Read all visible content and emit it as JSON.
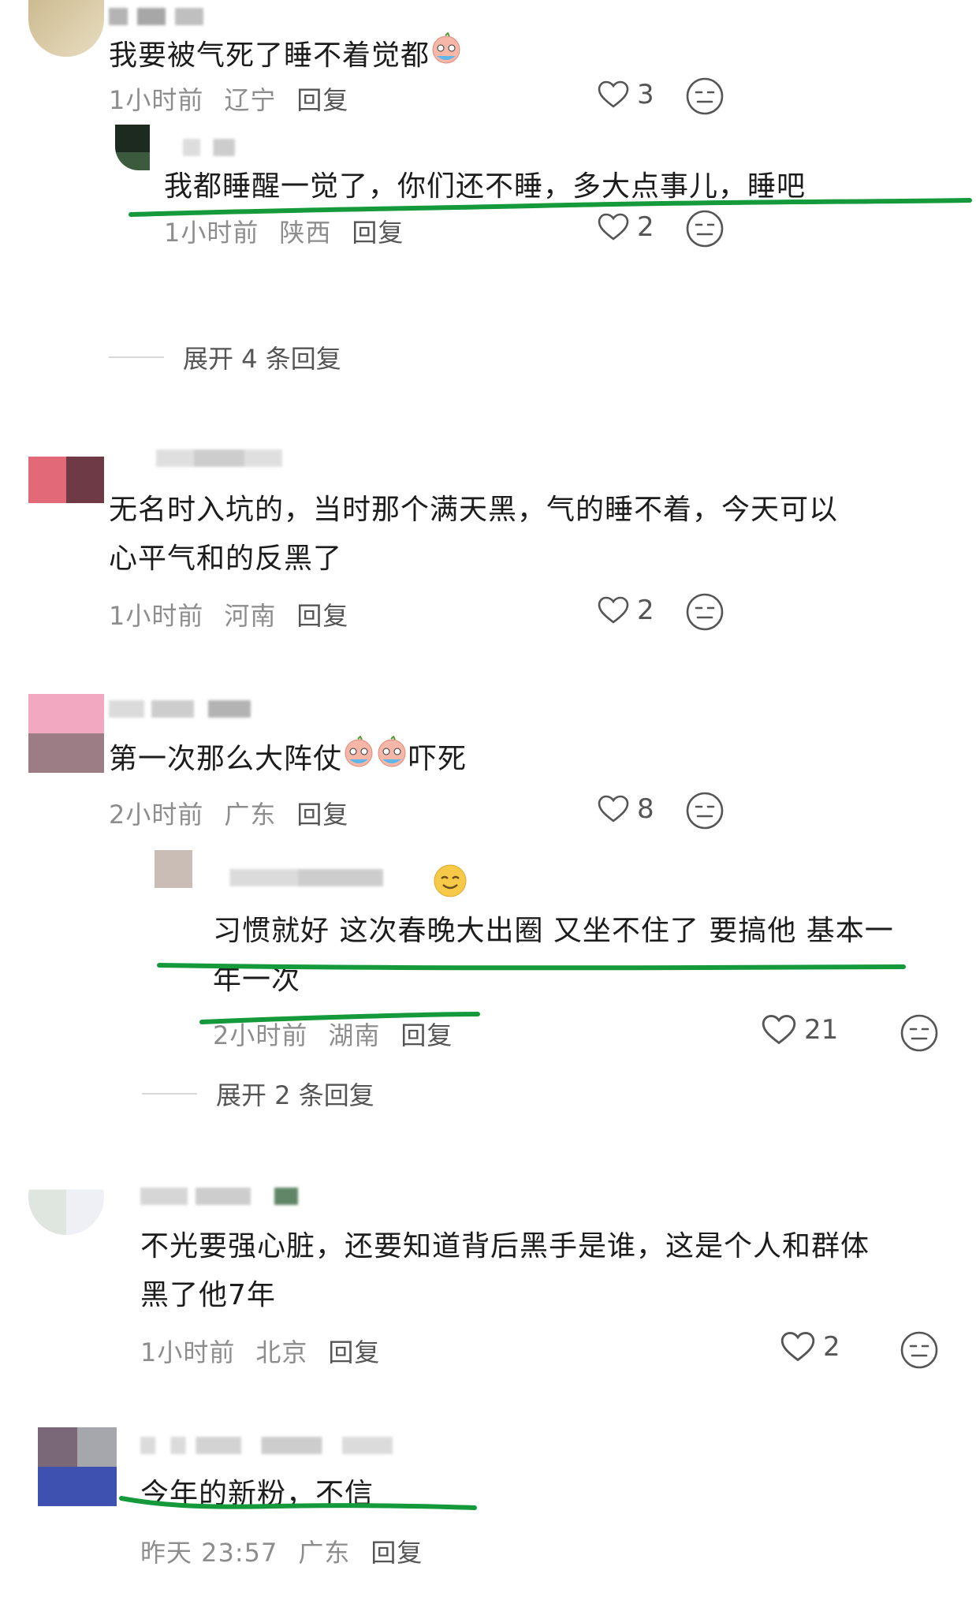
{
  "comments": [
    {
      "text": "我要被气死了睡不着觉都",
      "time": "1小时前",
      "location": "辽宁",
      "reply_label": "回复",
      "likes": "3"
    },
    {
      "text": "我都睡醒一觉了，你们还不睡，多大点事儿，睡吧",
      "time": "1小时前",
      "location": "陕西",
      "reply_label": "回复",
      "likes": "2",
      "expand": "展开 4 条回复"
    },
    {
      "text_line1": "无名时入坑的，当时那个满天黑，气的睡不着，今天可以",
      "text_line2": "心平气和的反黑了",
      "time": "1小时前",
      "location": "河南",
      "reply_label": "回复",
      "likes": "2"
    },
    {
      "text_before": "第一次那么大阵仗",
      "text_after": "吓死",
      "time": "2小时前",
      "location": "广东",
      "reply_label": "回复",
      "likes": "8"
    },
    {
      "text_line1": "习惯就好 这次春晚大出圈 又坐不住了 要搞他 基本一",
      "text_line2": "年一次",
      "time": "2小时前",
      "location": "湖南",
      "reply_label": "回复",
      "likes": "21",
      "expand": "展开 2 条回复"
    },
    {
      "text_line1": "不光要强心脏，还要知道背后黑手是谁，这是个人和群体",
      "text_line2": "黑了他7年",
      "time": "1小时前",
      "location": "北京",
      "reply_label": "回复",
      "likes": "2"
    },
    {
      "text": "今年的新粉，不信",
      "time": "昨天 23:57",
      "location": "广东",
      "reply_label": "回复"
    }
  ],
  "colors": {
    "highlight_green": "#159a3b",
    "meta_gray": "#8d8d8d"
  },
  "icons": {
    "like": "heart-outline-icon",
    "dislike": "neutral-face-icon",
    "emoji": "crying-face-emoji"
  }
}
